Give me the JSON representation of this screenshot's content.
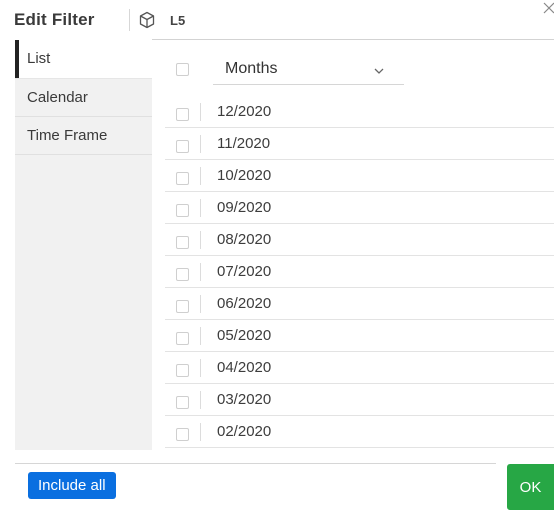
{
  "header": {
    "title": "Edit Filter",
    "model_name": "L5"
  },
  "sidebar": {
    "items": [
      {
        "label": "List",
        "active": true
      },
      {
        "label": "Calendar",
        "active": false
      },
      {
        "label": "Time Frame",
        "active": false
      }
    ]
  },
  "list_panel": {
    "dimension_select": "Months",
    "rows": [
      {
        "label": "12/2020",
        "checked": false
      },
      {
        "label": "11/2020",
        "checked": false
      },
      {
        "label": "10/2020",
        "checked": false
      },
      {
        "label": "09/2020",
        "checked": false
      },
      {
        "label": "08/2020",
        "checked": false
      },
      {
        "label": "07/2020",
        "checked": false
      },
      {
        "label": "06/2020",
        "checked": false
      },
      {
        "label": "05/2020",
        "checked": false
      },
      {
        "label": "04/2020",
        "checked": false
      },
      {
        "label": "03/2020",
        "checked": false
      },
      {
        "label": "02/2020",
        "checked": false
      }
    ]
  },
  "footer": {
    "include_all_label": "Include all",
    "ok_label": "OK"
  },
  "colors": {
    "primary_button": "#0a6fe0",
    "ok_button": "#27a745",
    "active_indicator": "#222222"
  }
}
